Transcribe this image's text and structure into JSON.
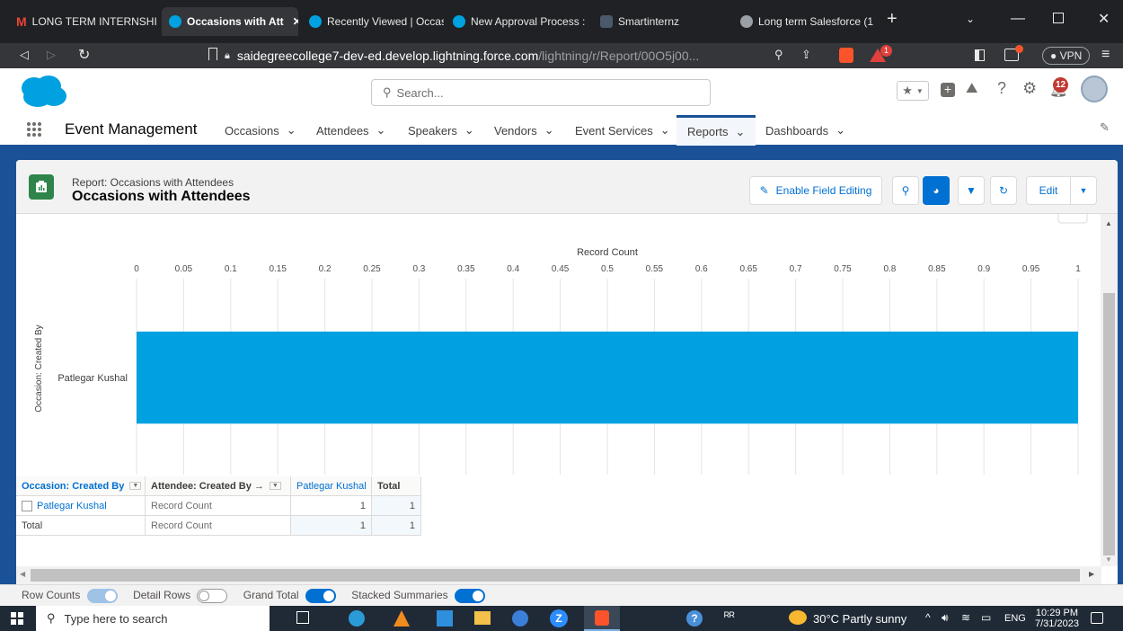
{
  "browser": {
    "tabs": [
      {
        "label": "LONG TERM INTERNSHI",
        "active": false
      },
      {
        "label": "Occasions with Att",
        "active": true
      },
      {
        "label": "Recently Viewed | Occas",
        "active": false
      },
      {
        "label": "New Approval Process :",
        "active": false
      },
      {
        "label": "Smartinternz",
        "active": false
      },
      {
        "label": "Long term Salesforce (1",
        "active": false
      }
    ],
    "url_domain": "saidegreecollege7-dev-ed.develop.lightning.force.com",
    "url_path": "/lightning/r/Report/00O5j00...",
    "vpn_label": "VPN",
    "brave_badge": "1"
  },
  "header": {
    "search_placeholder": "Search...",
    "notification_count": "12"
  },
  "nav": {
    "app_name": "Event Management",
    "items": [
      "Occasions",
      "Attendees",
      "Speakers",
      "Vendors",
      "Event Services",
      "Reports",
      "Dashboards"
    ],
    "active_index": 5
  },
  "report": {
    "type_label": "Report: Occasions with Attendees",
    "title": "Occasions with Attendees",
    "enable_field_editing": "Enable Field Editing",
    "edit_label": "Edit"
  },
  "chart_data": {
    "type": "bar",
    "orientation": "horizontal",
    "title": "Record Count",
    "ylabel": "Occasion: Created By",
    "categories": [
      "Patlegar Kushal"
    ],
    "values": [
      1
    ],
    "xlim": [
      0,
      1
    ],
    "ticks": [
      "0",
      "0.05",
      "0.1",
      "0.15",
      "0.2",
      "0.25",
      "0.3",
      "0.35",
      "0.4",
      "0.45",
      "0.5",
      "0.55",
      "0.6",
      "0.65",
      "0.7",
      "0.75",
      "0.8",
      "0.85",
      "0.9",
      "0.95",
      "1"
    ],
    "bar_color": "#00a1e0",
    "grid": true
  },
  "table": {
    "header": [
      "Occasion: Created By",
      "Attendee: Created By →",
      "Patlegar Kushal",
      "Total"
    ],
    "rows": [
      {
        "label": "Patlegar Kushal",
        "measure": "Record Count",
        "value": "1",
        "total": "1"
      },
      {
        "label": "Total",
        "measure": "Record Count",
        "value": "1",
        "total": "1"
      }
    ]
  },
  "footer": {
    "row_counts": "Row Counts",
    "detail_rows": "Detail Rows",
    "grand_total": "Grand Total",
    "stacked_summaries": "Stacked Summaries"
  },
  "taskbar": {
    "search_placeholder": "Type here to search",
    "weather": "30°C  Partly sunny",
    "lang": "ENG",
    "time": "10:29 PM",
    "date": "7/31/2023"
  }
}
